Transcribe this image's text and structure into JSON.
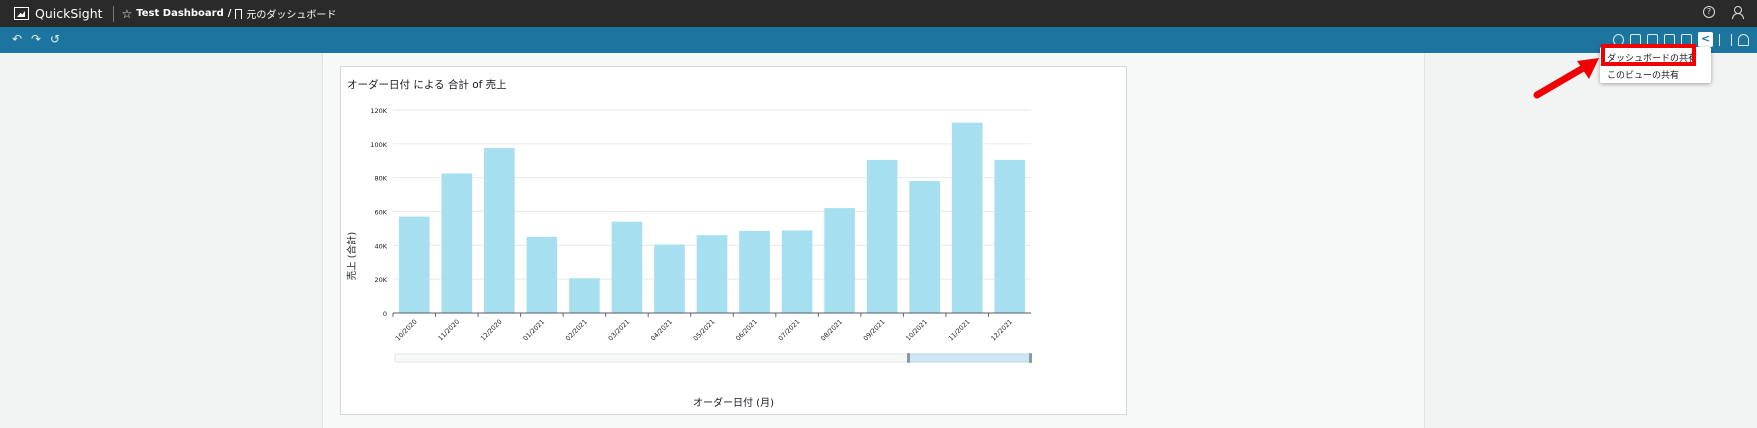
{
  "app": {
    "name": "QuickSight"
  },
  "breadcrumb": {
    "dashboard": "Test Dashboard",
    "separator": "/",
    "sheet": "元のダッシュボード"
  },
  "toolbar": {
    "undo_icon": "undo-icon",
    "redo_icon": "redo-icon",
    "reset_icon": "reset-icon"
  },
  "visual": {
    "title": "オーダー日付 による 合計 of 売上"
  },
  "share_menu": {
    "items": [
      "ダッシュボードの共有",
      "このビューの共有"
    ]
  },
  "colors": {
    "bar": "#a6dff0",
    "toolbar": "#1c759e",
    "topbar": "#2a2a2a",
    "highlight": "#f00000"
  },
  "chart_data": {
    "type": "bar",
    "title": "オーダー日付 による 合計 of 売上",
    "xlabel": "オーダー日付 (月)",
    "ylabel": "売上 (合計)",
    "categories": [
      "10/2020",
      "11/2020",
      "12/2020",
      "01/2021",
      "02/2021",
      "03/2021",
      "04/2021",
      "05/2021",
      "06/2021",
      "07/2021",
      "08/2021",
      "09/2021",
      "10/2021",
      "11/2021",
      "12/2021"
    ],
    "values": [
      57000,
      82500,
      97500,
      45000,
      20500,
      54000,
      40500,
      46000,
      48500,
      48800,
      62000,
      90500,
      78000,
      112500,
      90500
    ],
    "ylim": [
      0,
      120000
    ],
    "yticks": [
      "0",
      "20K",
      "40K",
      "60K",
      "80K",
      "100K",
      "120K"
    ],
    "grid": true
  }
}
